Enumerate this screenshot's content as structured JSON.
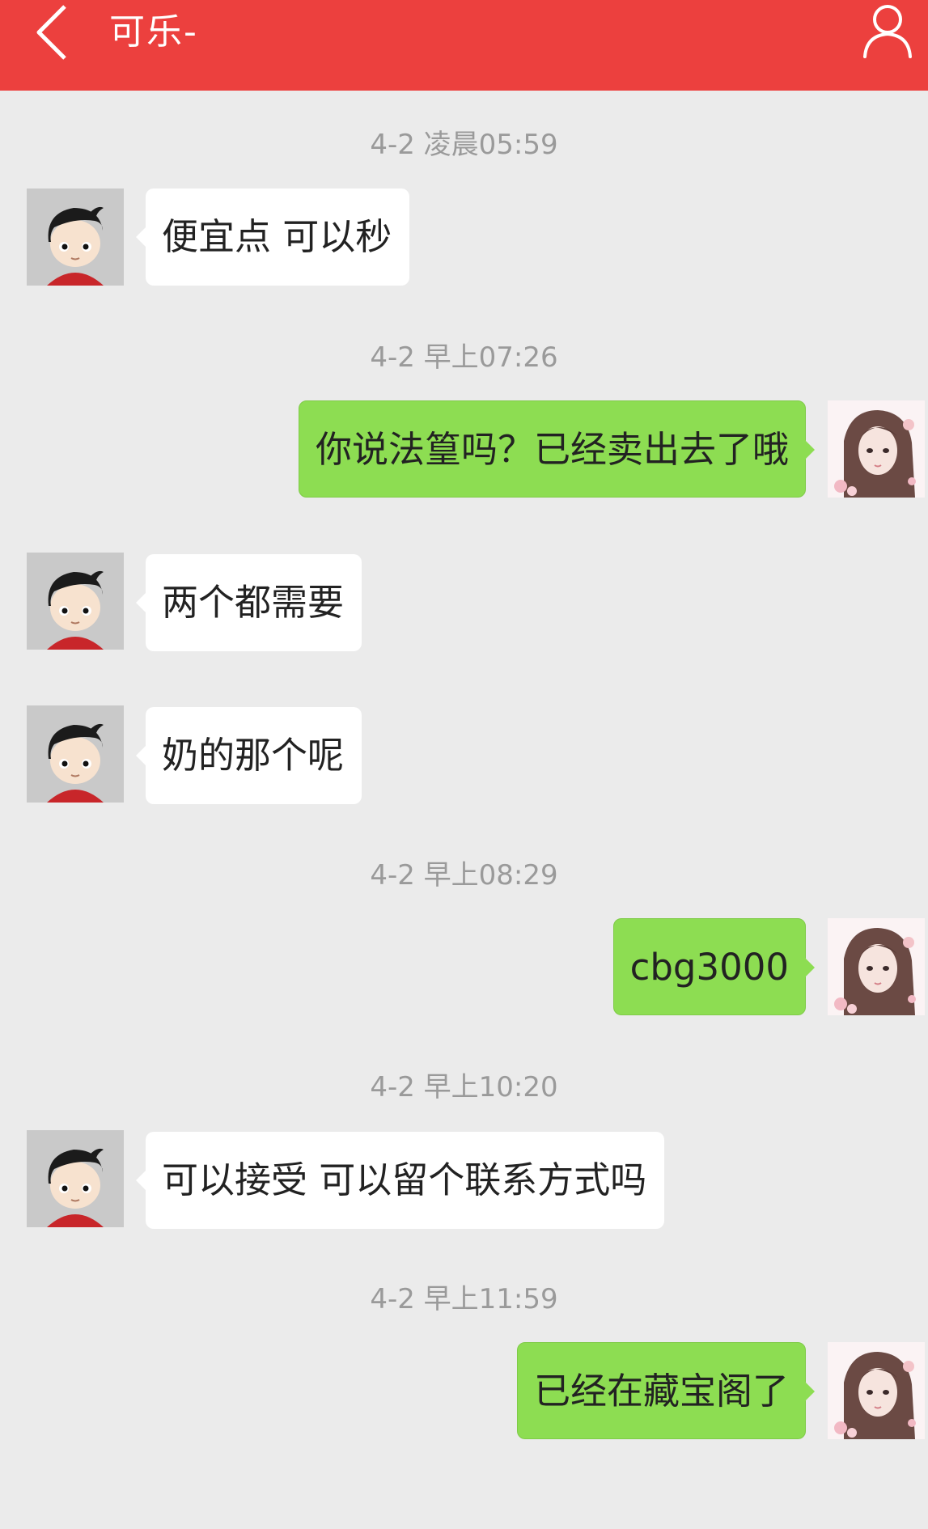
{
  "header": {
    "title": "可乐-",
    "back_icon": "chevron-left-icon",
    "profile_icon": "person-icon",
    "background_color": "#ec403e"
  },
  "messages": [
    {
      "type": "timestamp",
      "text": "4-2 凌晨05:59"
    },
    {
      "type": "incoming",
      "text": "便宜点 可以秒"
    },
    {
      "type": "timestamp",
      "text": "4-2 早上07:26"
    },
    {
      "type": "outgoing",
      "text": "你说法篁吗？已经卖出去了哦"
    },
    {
      "type": "incoming",
      "text": "两个都需要"
    },
    {
      "type": "incoming",
      "text": "奶的那个呢"
    },
    {
      "type": "timestamp",
      "text": "4-2 早上08:29"
    },
    {
      "type": "outgoing",
      "text": "cbg3000"
    },
    {
      "type": "timestamp",
      "text": "4-2 早上10:20"
    },
    {
      "type": "incoming",
      "text": "可以接受  可以留个联系方式吗"
    },
    {
      "type": "timestamp",
      "text": "4-2 早上11:59"
    },
    {
      "type": "outgoing",
      "text": "已经在藏宝阁了"
    }
  ],
  "colors": {
    "incoming_bubble": "#ffffff",
    "outgoing_bubble": "#8ddd52",
    "chat_background": "#ebebeb",
    "timestamp_text": "#9a9a9a"
  }
}
